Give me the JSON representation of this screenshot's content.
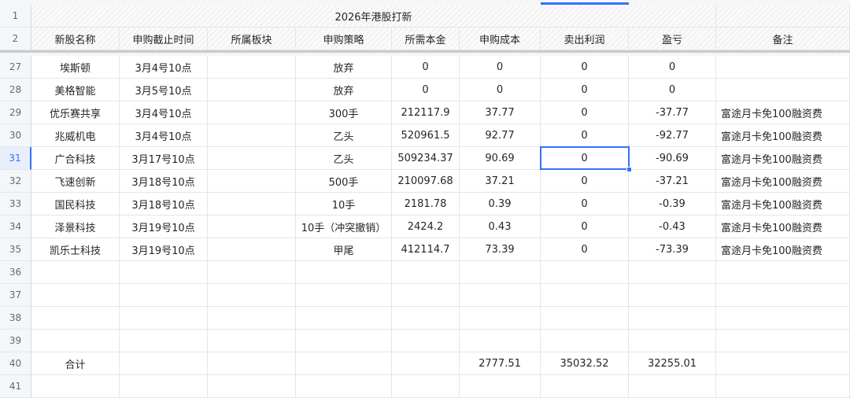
{
  "title": "2026年港股打新",
  "selected_row": "31",
  "headers": [
    "新股名称",
    "申购截止时间",
    "所属板块",
    "申购策略",
    "所需本金",
    "申购成本",
    "卖出利润",
    "盈亏",
    "备注"
  ],
  "rows": [
    {
      "num": "27",
      "cells": [
        "埃斯顿",
        "3月4号10点",
        "",
        "放弃",
        "0",
        "0",
        "0",
        "0",
        ""
      ]
    },
    {
      "num": "28",
      "cells": [
        "美格智能",
        "3月5号10点",
        "",
        "放弃",
        "0",
        "0",
        "0",
        "0",
        ""
      ]
    },
    {
      "num": "29",
      "cells": [
        "优乐赛共享",
        "3月4号10点",
        "",
        "300手",
        "212117.9",
        "37.77",
        "0",
        "-37.77",
        "富途月卡免100融资费"
      ]
    },
    {
      "num": "30",
      "cells": [
        "兆威机电",
        "3月4号10点",
        "",
        "乙头",
        "520961.5",
        "92.77",
        "0",
        "-92.77",
        "富途月卡免100融资费"
      ]
    },
    {
      "num": "31",
      "cells": [
        "广合科技",
        "3月17号10点",
        "",
        "乙头",
        "509234.37",
        "90.69",
        "0",
        "-90.69",
        "富途月卡免100融资费"
      ]
    },
    {
      "num": "32",
      "cells": [
        "飞速创新",
        "3月18号10点",
        "",
        "500手",
        "210097.68",
        "37.21",
        "0",
        "-37.21",
        "富途月卡免100融资费"
      ]
    },
    {
      "num": "33",
      "cells": [
        "国民科技",
        "3月18号10点",
        "",
        "10手",
        "2181.78",
        "0.39",
        "0",
        "-0.39",
        "富途月卡免100融资费"
      ]
    },
    {
      "num": "34",
      "cells": [
        "泽景科技",
        "3月19号10点",
        "",
        "10手（冲突撤销）",
        "2424.2",
        "0.43",
        "0",
        "-0.43",
        "富途月卡免100融资费"
      ]
    },
    {
      "num": "35",
      "cells": [
        "凯乐士科技",
        "3月19号10点",
        "",
        "甲尾",
        "412114.7",
        "73.39",
        "0",
        "-73.39",
        "富途月卡免100融资费"
      ]
    },
    {
      "num": "36",
      "cells": [
        "",
        "",
        "",
        "",
        "",
        "",
        "",
        "",
        ""
      ]
    },
    {
      "num": "37",
      "cells": [
        "",
        "",
        "",
        "",
        "",
        "",
        "",
        "",
        ""
      ]
    },
    {
      "num": "38",
      "cells": [
        "",
        "",
        "",
        "",
        "",
        "",
        "",
        "",
        ""
      ]
    },
    {
      "num": "39",
      "cells": [
        "",
        "",
        "",
        "",
        "",
        "",
        "",
        "",
        ""
      ]
    },
    {
      "num": "40",
      "cells": [
        "合计",
        "",
        "",
        "",
        "",
        "2777.51",
        "35032.52",
        "32255.01",
        ""
      ]
    },
    {
      "num": "41",
      "cells": [
        "",
        "",
        "",
        "",
        "",
        "",
        "",
        "",
        ""
      ]
    }
  ]
}
